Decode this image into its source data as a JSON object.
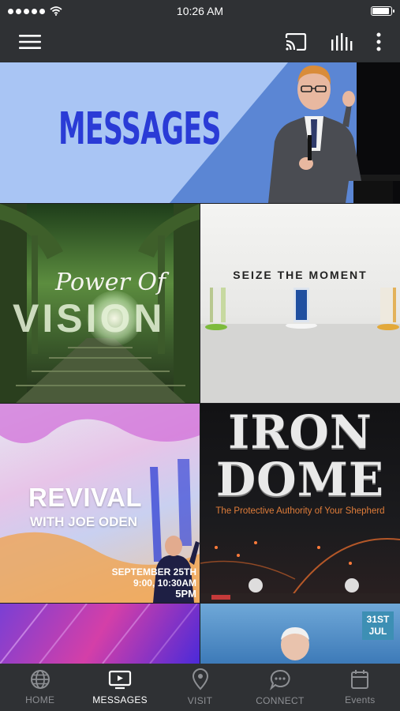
{
  "status_bar": {
    "time": "10:26 AM",
    "signal_bars": 5,
    "battery_level": 0.9
  },
  "app_bar": {
    "icons": [
      "hamburger-menu-icon",
      "cast-icon",
      "audio-bars-icon",
      "more-vertical-icon"
    ]
  },
  "hero": {
    "title": "MESSAGES"
  },
  "tiles": [
    {
      "line1": "Power Of",
      "line2": "VISION"
    },
    {
      "title": "SEIZE  THE  MOMENT"
    },
    {
      "title": "REVIVAL",
      "subtitle": "WITH JOE ODEN",
      "date": "SEPTEMBER 25TH",
      "times": "9:00, 10:30AM",
      "time_big": "5PM"
    },
    {
      "title_line1": "IRON",
      "title_line2": "DOME",
      "subtitle": "The Protective Authority of Your Shepherd"
    },
    {},
    {
      "badge_line1": "31ST",
      "badge_line2": "JUL"
    }
  ],
  "bottom_nav": {
    "active_index": 1,
    "items": [
      {
        "label": "HOME",
        "icon": "globe-icon"
      },
      {
        "label": "MESSAGES",
        "icon": "tv-play-icon"
      },
      {
        "label": "VISIT",
        "icon": "location-pin-icon"
      },
      {
        "label": "CONNECT",
        "icon": "chat-bubble-icon"
      },
      {
        "label": "Events",
        "icon": "calendar-icon"
      }
    ]
  },
  "colors": {
    "bar_bg": "#2f3134",
    "nav_active": "#ffffff",
    "nav_inactive": "#8d8f93",
    "hero_blue": "#2a3bd6",
    "hero_light": "#a9c5f4"
  }
}
